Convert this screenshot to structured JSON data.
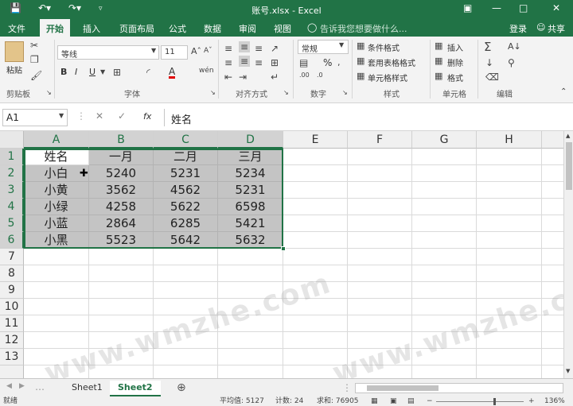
{
  "titlebar": {
    "title": "账号.xlsx - Excel",
    "save_icon": "save-icon",
    "undo_icon": "undo-icon",
    "redo_icon": "redo-icon",
    "qa_customize_icon": "customize-icon",
    "ribbon_display_icon": "ribbon-display-icon",
    "minimize_icon": "minimize-icon",
    "maximize_icon": "maximize-icon",
    "close_icon": "close-icon",
    "color": "#217346"
  },
  "tabs": [
    "文件",
    "开始",
    "插入",
    "页面布局",
    "公式",
    "数据",
    "审阅",
    "视图"
  ],
  "active_tab": "开始",
  "search_placeholder": "告诉我您想要做什么...",
  "login_label": "登录",
  "share_label": "共享",
  "ribbon": {
    "clipboard": {
      "paste_label": "粘贴",
      "group_label": "剪贴板"
    },
    "font": {
      "font_name": "等线",
      "font_size": "11",
      "bold": "B",
      "italic": "I",
      "underline": "U",
      "font_color_label": "A",
      "group_label": "字体"
    },
    "alignment": {
      "group_label": "对齐方式"
    },
    "number": {
      "format": "常规",
      "percent": "%",
      "group_label": "数字"
    },
    "styles": {
      "conditional": "条件格式",
      "table": "套用表格格式",
      "cell": "单元格样式",
      "group_label": "样式"
    },
    "cells": {
      "insert": "插入",
      "delete": "删除",
      "format": "格式",
      "group_label": "单元格"
    },
    "editing": {
      "group_label": "编辑"
    }
  },
  "formula_bar": {
    "name_box": "A1",
    "fx": "fx",
    "content": "姓名"
  },
  "columns": [
    "A",
    "B",
    "C",
    "D",
    "E",
    "F",
    "G",
    "H"
  ],
  "rows": [
    "1",
    "2",
    "3",
    "4",
    "5",
    "6",
    "7",
    "8",
    "9",
    "10",
    "11",
    "12",
    "13"
  ],
  "table": [
    [
      "姓名",
      "一月",
      "二月",
      "三月"
    ],
    [
      "小白",
      "5240",
      "5231",
      "5234"
    ],
    [
      "小黄",
      "3562",
      "4562",
      "5231"
    ],
    [
      "小绿",
      "4258",
      "5622",
      "6598"
    ],
    [
      "小蓝",
      "2864",
      "6285",
      "5421"
    ],
    [
      "小黑",
      "5523",
      "5642",
      "5632"
    ]
  ],
  "watermark": "www.wmzhe.com",
  "sheets": [
    "Sheet1",
    "Sheet2"
  ],
  "active_sheet": "Sheet2",
  "status": {
    "ready": "就绪",
    "average": "平均值: 5127",
    "count": "计数: 24",
    "sum": "求和: 76905",
    "zoom": "136%"
  }
}
